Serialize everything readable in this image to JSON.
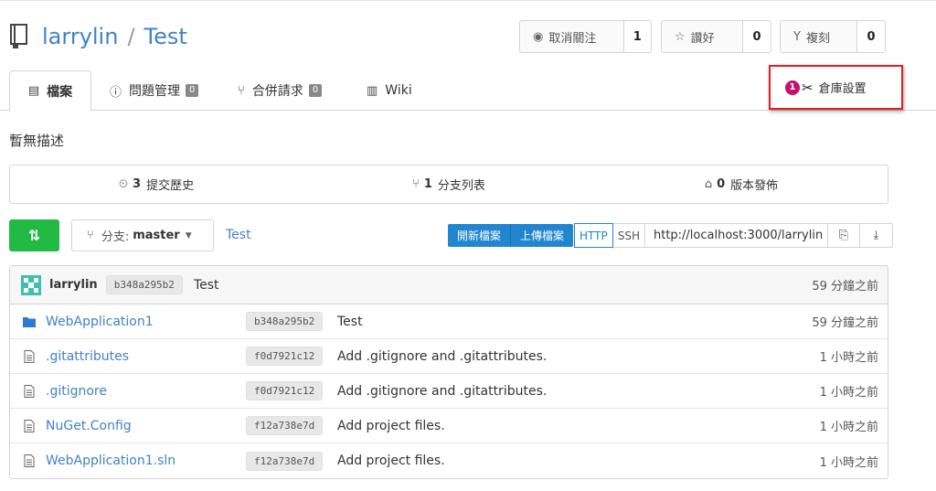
{
  "repo": {
    "owner": "larrylin",
    "separator": "/",
    "name": "Test"
  },
  "actions": {
    "unwatch": {
      "label": "取消關注",
      "count": "1"
    },
    "star": {
      "label": "讚好",
      "count": "0"
    },
    "fork": {
      "label": "複刻",
      "count": "0"
    }
  },
  "tabs": [
    {
      "label": "檔案"
    },
    {
      "label": "問題管理",
      "badge": "0"
    },
    {
      "label": "合併請求",
      "badge": "0"
    },
    {
      "label": "Wiki"
    }
  ],
  "settings": {
    "number": "1",
    "label": "倉庫設置"
  },
  "description": "暫無描述",
  "stats": {
    "commits": {
      "count": "3",
      "label": "提交歷史"
    },
    "branches": {
      "count": "1",
      "label": "分支列表"
    },
    "releases": {
      "count": "0",
      "label": "版本發佈"
    }
  },
  "branch": {
    "prefix": "分支:",
    "name": "master"
  },
  "breadcrumb": "Test",
  "file_buttons": {
    "new_file": "開新檔案",
    "upload_file": "上傳檔案"
  },
  "clone": {
    "http": "HTTP",
    "ssh": "SSH",
    "url": "http://localhost:3000/larrylin"
  },
  "latest_commit": {
    "author": "larrylin",
    "sha": "b348a295b2",
    "message": "Test",
    "time": "59 分鐘之前"
  },
  "files": [
    {
      "name": "WebApplication1",
      "type": "folder",
      "sha": "b348a295b2",
      "message": "Test",
      "time": "59 分鐘之前"
    },
    {
      "name": ".gitattributes",
      "type": "file",
      "sha": "f0d7921c12",
      "message": "Add .gitignore and .gitattributes.",
      "time": "1 小時之前"
    },
    {
      "name": ".gitignore",
      "type": "file",
      "sha": "f0d7921c12",
      "message": "Add .gitignore and .gitattributes.",
      "time": "1 小時之前"
    },
    {
      "name": "NuGet.Config",
      "type": "file",
      "sha": "f12a738e7d",
      "message": "Add project files.",
      "time": "1 小時之前"
    },
    {
      "name": "WebApplication1.sln",
      "type": "file",
      "sha": "f12a738e7d",
      "message": "Add project files.",
      "time": "1 小時之前"
    }
  ]
}
